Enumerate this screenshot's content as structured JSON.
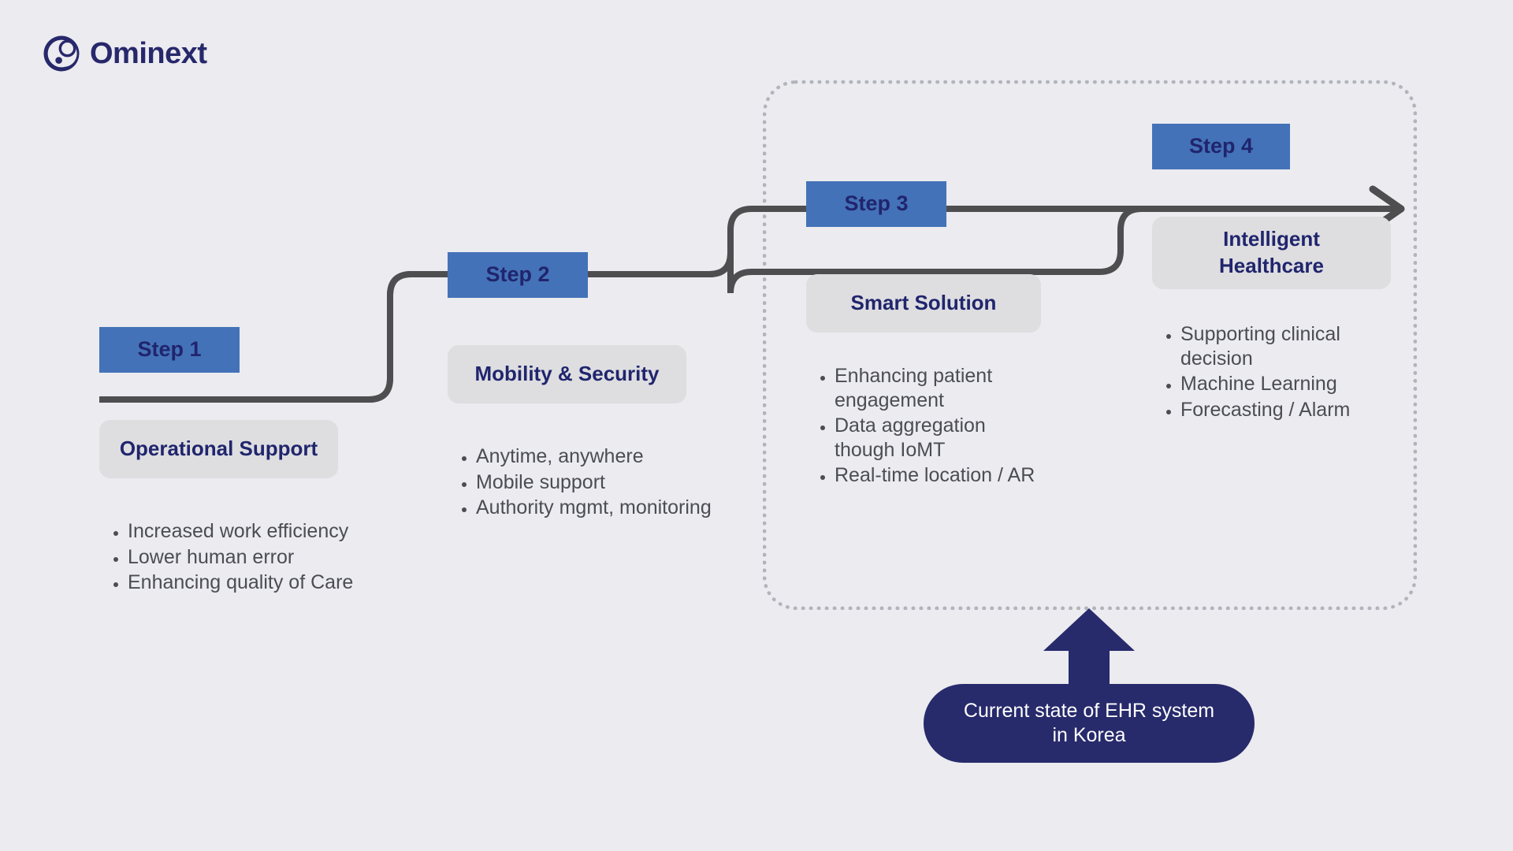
{
  "brand": {
    "name": "Ominext",
    "logo_icon": "ominext-swirl-icon",
    "color": "#27286b"
  },
  "colors": {
    "background": "#ebebf0",
    "step_badge": "#4472b8",
    "step_badge_text": "#20256d",
    "title_chip": "#dedee0",
    "title_text": "#20256d",
    "bullet_text": "#4b4d52",
    "connector_line": "#4e4e50",
    "dotted_border": "#b2b4bc",
    "callout_fill": "#272a6b",
    "callout_text": "#ffffff"
  },
  "steps": [
    {
      "badge": "Step 1",
      "title": "Operational Support",
      "bullets": [
        "Increased work efficiency",
        "Lower human error",
        "Enhancing quality of Care"
      ]
    },
    {
      "badge": "Step 2",
      "title": "Mobility  & Security",
      "bullets": [
        "Anytime, anywhere",
        "Mobile support",
        "Authority mgmt, monitoring"
      ]
    },
    {
      "badge": "Step 3",
      "title": "Smart Solution",
      "bullets": [
        "Enhancing patient engagement",
        "Data aggregation though IoMT",
        "Real-time location / AR"
      ]
    },
    {
      "badge": "Step 4",
      "title_line1": "Intelligent",
      "title_line2": "Healthcare",
      "bullets": [
        "Supporting clinical decision",
        "Machine Learning",
        "Forecasting / Alarm"
      ]
    }
  ],
  "callout": {
    "text": "Current state of EHR system in Korea",
    "arrow_icon": "arrow-up-icon"
  },
  "connector": {
    "arrow_icon": "arrow-right-icon"
  },
  "grouping": {
    "label": "dotted-group-boundary"
  }
}
